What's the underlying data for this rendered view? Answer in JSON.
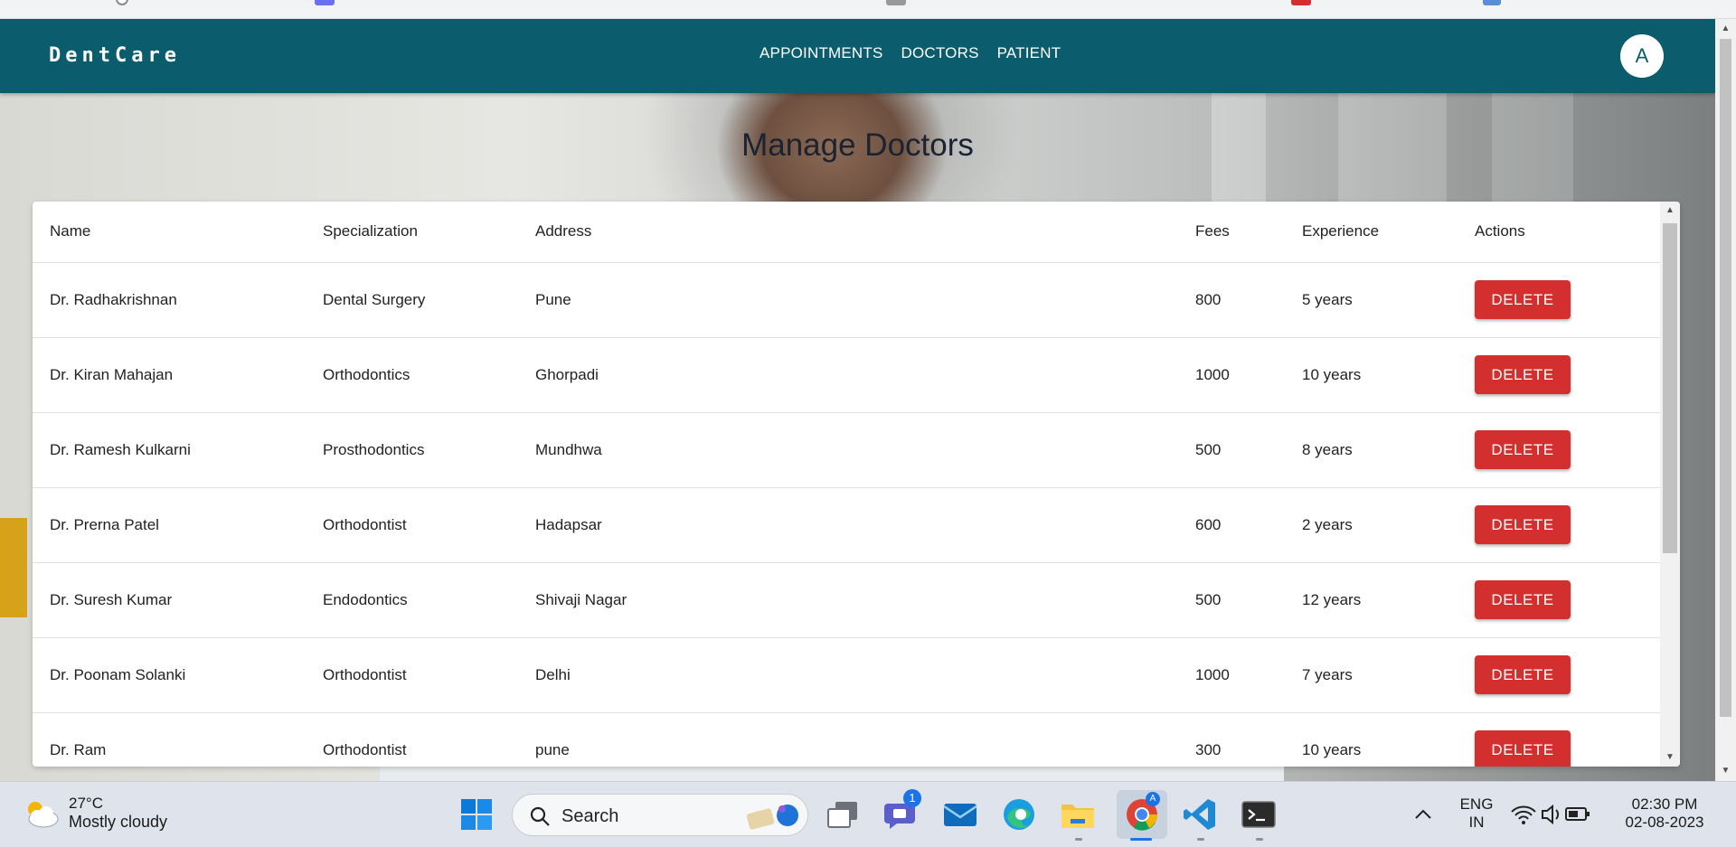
{
  "app": {
    "brand": "DentCare",
    "nav": [
      "APPOINTMENTS",
      "DOCTORS",
      "PATIENT"
    ],
    "avatar_letter": "A"
  },
  "page": {
    "title": "Manage Doctors"
  },
  "table": {
    "headers": [
      "Name",
      "Specialization",
      "Address",
      "Fees",
      "Experience",
      "Actions"
    ],
    "rows": [
      {
        "name": "Dr. Radhakrishnan",
        "specialization": "Dental Surgery",
        "address": "Pune",
        "fees": "800",
        "experience": "5 years",
        "action": "DELETE"
      },
      {
        "name": "Dr. Kiran Mahajan",
        "specialization": "Orthodontics",
        "address": "Ghorpadi",
        "fees": "1000",
        "experience": "10 years",
        "action": "DELETE"
      },
      {
        "name": "Dr. Ramesh Kulkarni",
        "specialization": "Prosthodontics",
        "address": "Mundhwa",
        "fees": "500",
        "experience": "8 years",
        "action": "DELETE"
      },
      {
        "name": "Dr. Prerna Patel",
        "specialization": "Orthodontist",
        "address": "Hadapsar",
        "fees": "600",
        "experience": "2 years",
        "action": "DELETE"
      },
      {
        "name": "Dr. Suresh Kumar",
        "specialization": "Endodontics",
        "address": "Shivaji Nagar",
        "fees": "500",
        "experience": "12 years",
        "action": "DELETE"
      },
      {
        "name": "Dr. Poonam Solanki",
        "specialization": "Orthodontist",
        "address": "Delhi",
        "fees": "1000",
        "experience": "7 years",
        "action": "DELETE"
      },
      {
        "name": "Dr. Ram",
        "specialization": "Orthodontist",
        "address": "pune",
        "fees": "300",
        "experience": "10 years",
        "action": "DELETE"
      }
    ]
  },
  "taskbar": {
    "weather_temp": "27°C",
    "weather_condition": "Mostly cloudy",
    "search_label": "Search",
    "chat_badge": "1",
    "language_line1": "ENG",
    "language_line2": "IN",
    "time": "02:30 PM",
    "date": "02-08-2023"
  },
  "colors": {
    "appbar": "#0b5d6e",
    "delete_button": "#d32f2f"
  }
}
